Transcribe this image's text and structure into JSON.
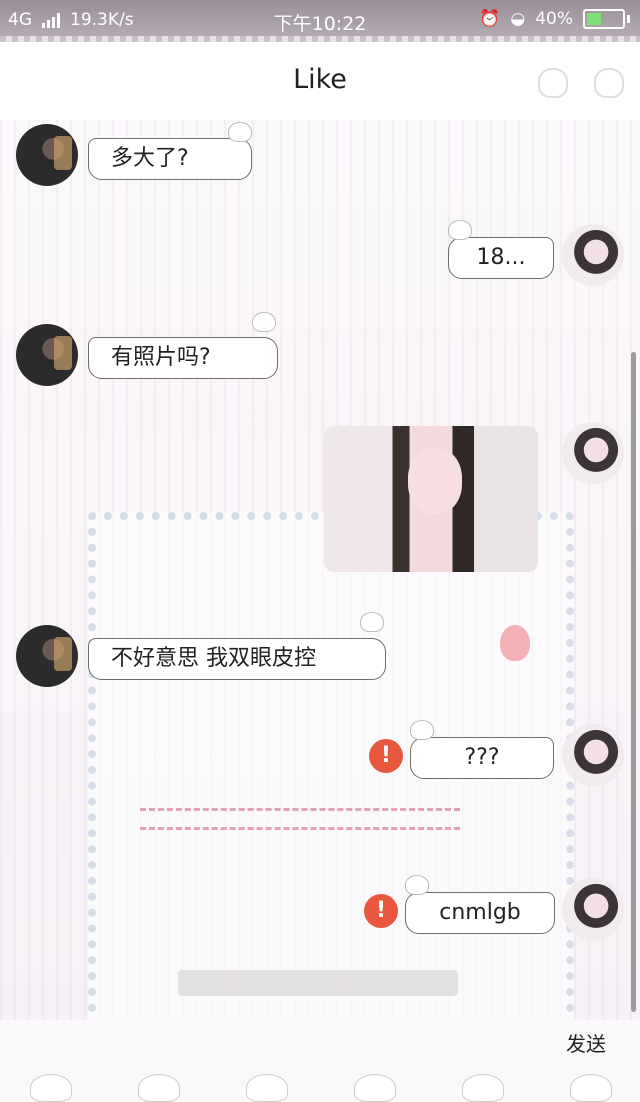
{
  "status_bar": {
    "network": "4G",
    "speed": "19.3K/s",
    "time": "下午10:22",
    "battery": "40%"
  },
  "header": {
    "title": "Like"
  },
  "messages": [
    {
      "side": "friend",
      "text": "多大了?"
    },
    {
      "side": "me",
      "text": "18..."
    },
    {
      "side": "friend",
      "text": "有照片吗?"
    },
    {
      "side": "me",
      "type": "image"
    },
    {
      "side": "friend",
      "text": "不好意思 我双眼皮控"
    },
    {
      "side": "me",
      "text": "???",
      "failed": true
    },
    {
      "side": "me",
      "text": "cnmlgb",
      "failed": true
    }
  ],
  "composer": {
    "send_label": "发送"
  },
  "icons": {
    "alert": "!",
    "error_color": "#e9573f"
  }
}
